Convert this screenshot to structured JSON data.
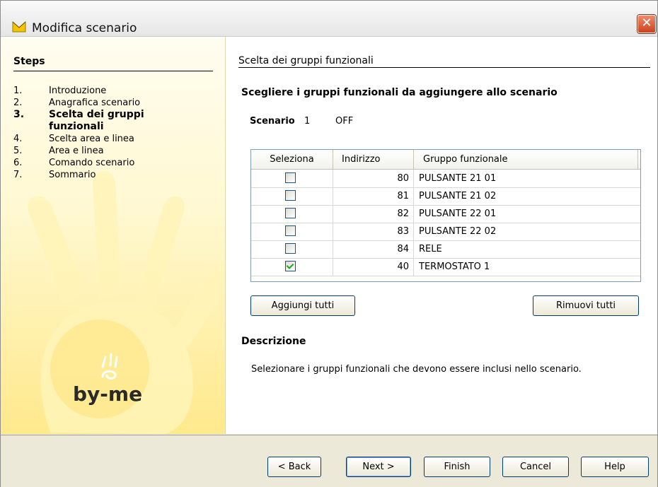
{
  "window": {
    "title": "Modifica scenario",
    "icon": "app-icon",
    "close_glyph": "✕"
  },
  "steps": {
    "title": "Steps",
    "items": [
      {
        "num": "1.",
        "label": "Introduzione"
      },
      {
        "num": "2.",
        "label": "Anagrafica scenario"
      },
      {
        "num": "3.",
        "label": "Scelta dei gruppi funzionali",
        "current": true
      },
      {
        "num": "4.",
        "label": "Scelta area e linea"
      },
      {
        "num": "5.",
        "label": "Area e linea"
      },
      {
        "num": "6.",
        "label": "Comando scenario"
      },
      {
        "num": "7.",
        "label": "Sommario"
      }
    ]
  },
  "logo": {
    "text": "by-me"
  },
  "main": {
    "section_title": "Scelta dei gruppi funzionali",
    "heading": "Scegliere i gruppi funzionali da aggiungere allo scenario",
    "scenario_label": "Scenario",
    "scenario_number": "1",
    "scenario_state": "OFF"
  },
  "table": {
    "columns": [
      "Seleziona",
      "Indirizzo",
      "Gruppo funzionale"
    ],
    "rows": [
      {
        "checked": false,
        "address": "80",
        "group": "PULSANTE 21 01"
      },
      {
        "checked": false,
        "address": "81",
        "group": "PULSANTE 21 02"
      },
      {
        "checked": false,
        "address": "82",
        "group": "PULSANTE 22 01"
      },
      {
        "checked": false,
        "address": "83",
        "group": "PULSANTE 22 02"
      },
      {
        "checked": false,
        "address": "84",
        "group": "RELE"
      },
      {
        "checked": true,
        "address": "40",
        "group": "TERMOSTATO 1"
      }
    ]
  },
  "actions": {
    "add_all": "Aggiungi tutti",
    "remove_all": "Rimuovi tutti"
  },
  "description": {
    "title": "Descrizione",
    "text": "Selezionare i gruppi funzionali che devono essere inclusi nello scenario."
  },
  "footer": {
    "back": "< Back",
    "next": "Next >",
    "finish": "Finish",
    "cancel": "Cancel",
    "help": "Help"
  },
  "colors": {
    "accent": "#003c74",
    "sidebar_yellow": "#ffe98c",
    "check_green": "#21a121",
    "close_red": "#c9421e"
  }
}
